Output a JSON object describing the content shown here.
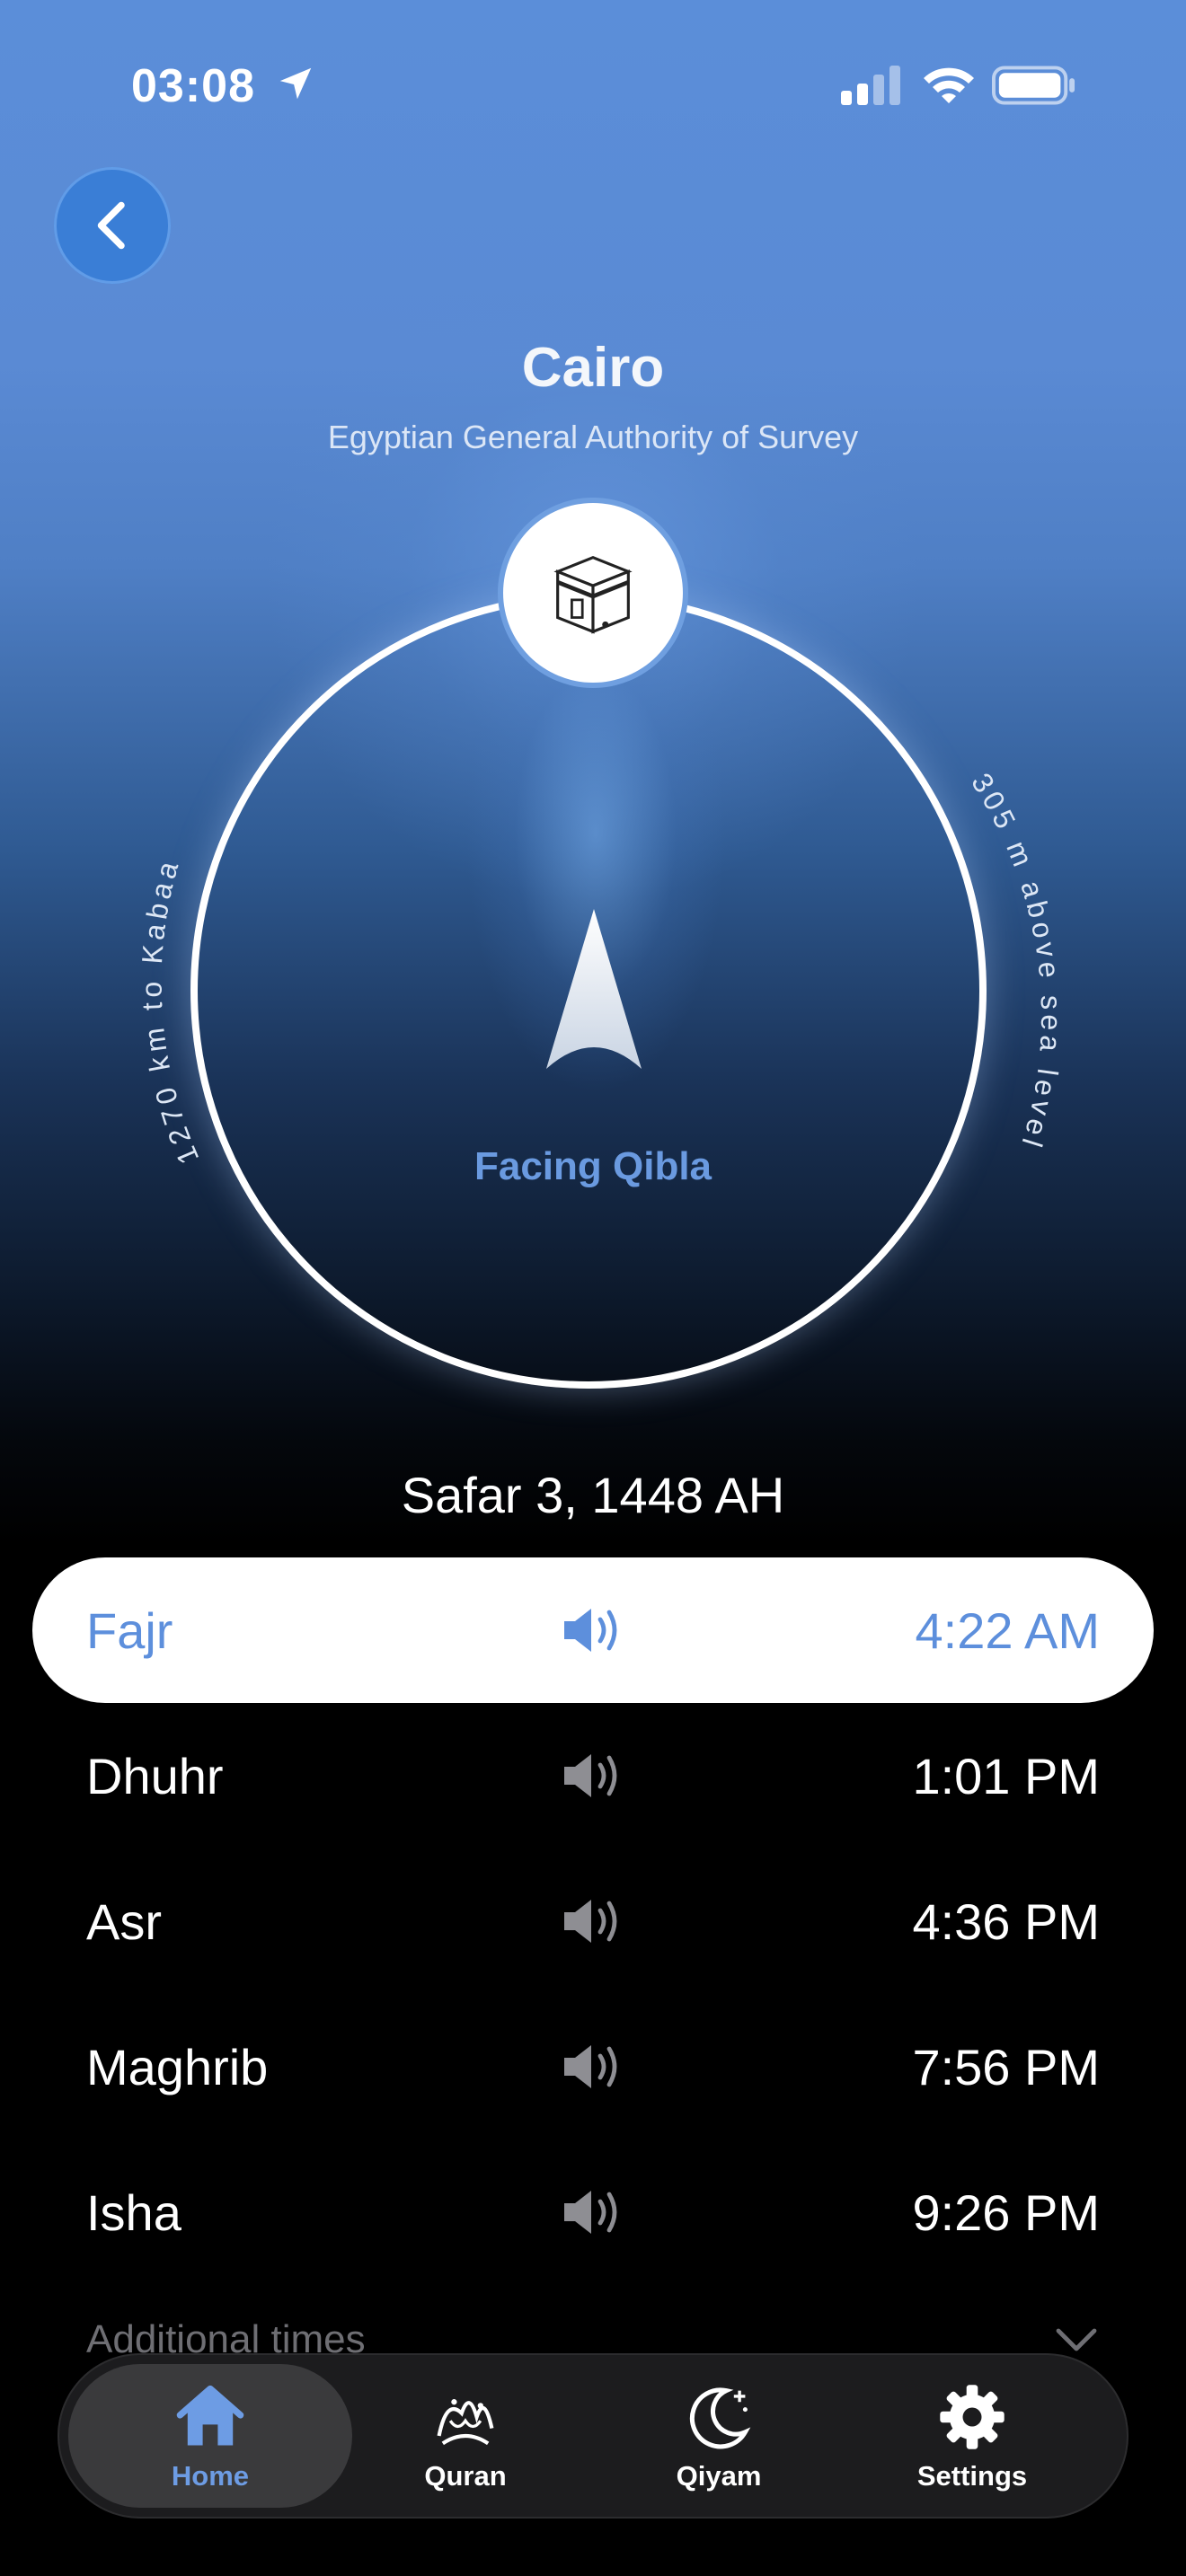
{
  "status": {
    "time": "03:08"
  },
  "header": {
    "city": "Cairo",
    "method": "Egyptian General Authority of Survey"
  },
  "compass": {
    "distance": "1270 km to Kabaa",
    "elevation": "305 m above sea level",
    "facing": "Facing Qibla"
  },
  "hijri_date": "Safar 3, 1448 AH",
  "prayers": [
    {
      "name": "Fajr",
      "time": "4:22 AM",
      "active": true
    },
    {
      "name": "Dhuhr",
      "time": "1:01 PM",
      "active": false
    },
    {
      "name": "Asr",
      "time": "4:36 PM",
      "active": false
    },
    {
      "name": "Maghrib",
      "time": "7:56 PM",
      "active": false
    },
    {
      "name": "Isha",
      "time": "9:26 PM",
      "active": false
    }
  ],
  "additional_label": "Additional times",
  "tabs": [
    {
      "label": "Home",
      "icon": "home-icon"
    },
    {
      "label": "Quran",
      "icon": "quran-icon"
    },
    {
      "label": "Qiyam",
      "icon": "moon-icon"
    },
    {
      "label": "Settings",
      "icon": "gear-icon"
    }
  ],
  "colors": {
    "accent": "#5d8fdc",
    "back_button": "#3a7ed6"
  }
}
